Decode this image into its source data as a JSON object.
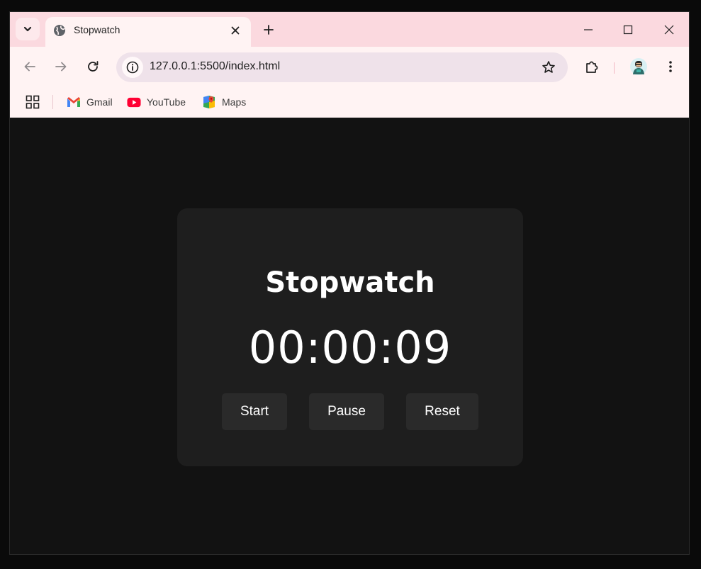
{
  "browser": {
    "tab": {
      "title": "Stopwatch"
    },
    "address_bar": {
      "url": "127.0.0.1:5500/index.html"
    },
    "bookmarks": [
      {
        "label": "Gmail",
        "icon": "gmail-icon"
      },
      {
        "label": "YouTube",
        "icon": "youtube-icon"
      },
      {
        "label": "Maps",
        "icon": "maps-icon"
      }
    ],
    "colors": {
      "tabstrip": "#fbd9df",
      "toolbar": "#fff3f3",
      "omnibox": "#efe2ea"
    }
  },
  "app": {
    "title": "Stopwatch",
    "time": "00:00:09",
    "buttons": {
      "start": "Start",
      "pause": "Pause",
      "reset": "Reset"
    },
    "colors": {
      "page_bg": "#121212",
      "card_bg": "#1e1e1e",
      "button_bg": "#2a2a2a",
      "text": "#ffffff"
    }
  }
}
